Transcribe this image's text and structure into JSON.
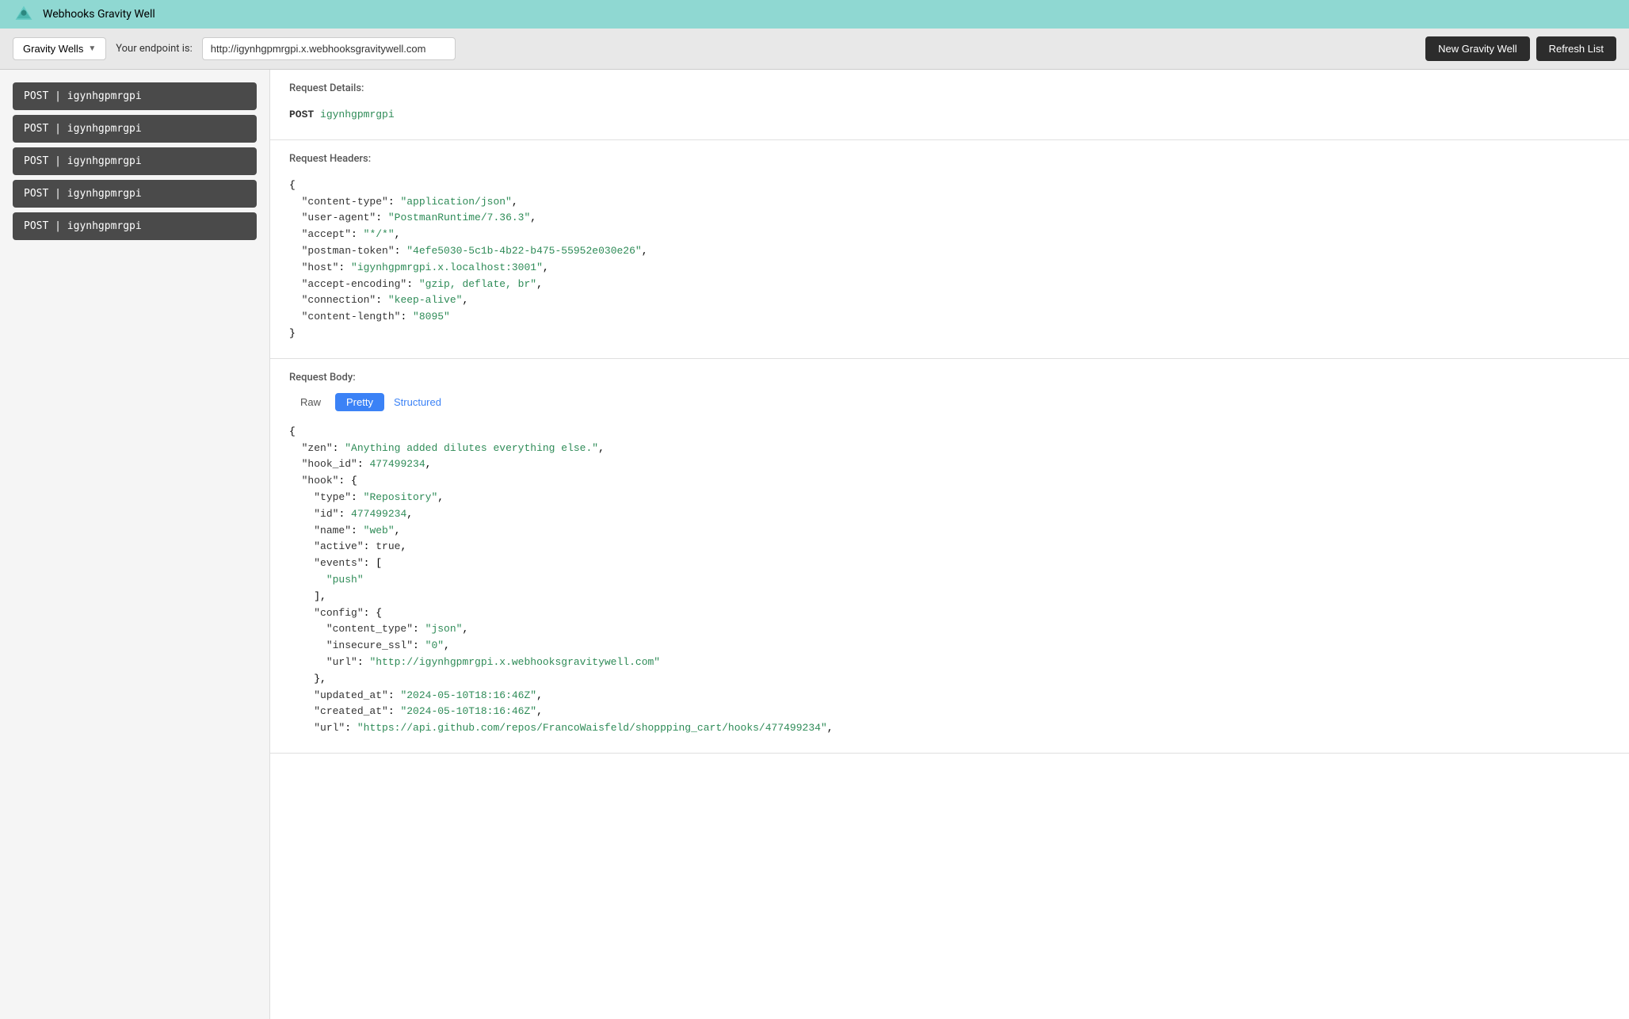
{
  "app": {
    "title": "Webhooks Gravity Well"
  },
  "toolbar": {
    "gravity_wells_label": "Gravity Wells",
    "endpoint_label": "Your endpoint is:",
    "endpoint_value": "http://igynhgpmrgpi.x.webhooksgravitywell.com",
    "new_gravity_well_label": "New Gravity Well",
    "refresh_list_label": "Refresh List"
  },
  "left_panel": {
    "requests": [
      {
        "label": "POST | igynhgpmrgpi"
      },
      {
        "label": "POST | igynhgpmrgpi"
      },
      {
        "label": "POST | igynhgpmrgpi"
      },
      {
        "label": "POST | igynhgpmrgpi"
      },
      {
        "label": "POST | igynhgpmrgpi"
      }
    ]
  },
  "right_panel": {
    "request_details_title": "Request Details:",
    "request_details_method": "POST",
    "request_details_path": "igynhgpmrgpi",
    "request_headers_title": "Request Headers:",
    "request_body_title": "Request Body:",
    "tabs": {
      "raw": "Raw",
      "pretty": "Pretty",
      "structured": "Structured",
      "active": "pretty"
    }
  }
}
